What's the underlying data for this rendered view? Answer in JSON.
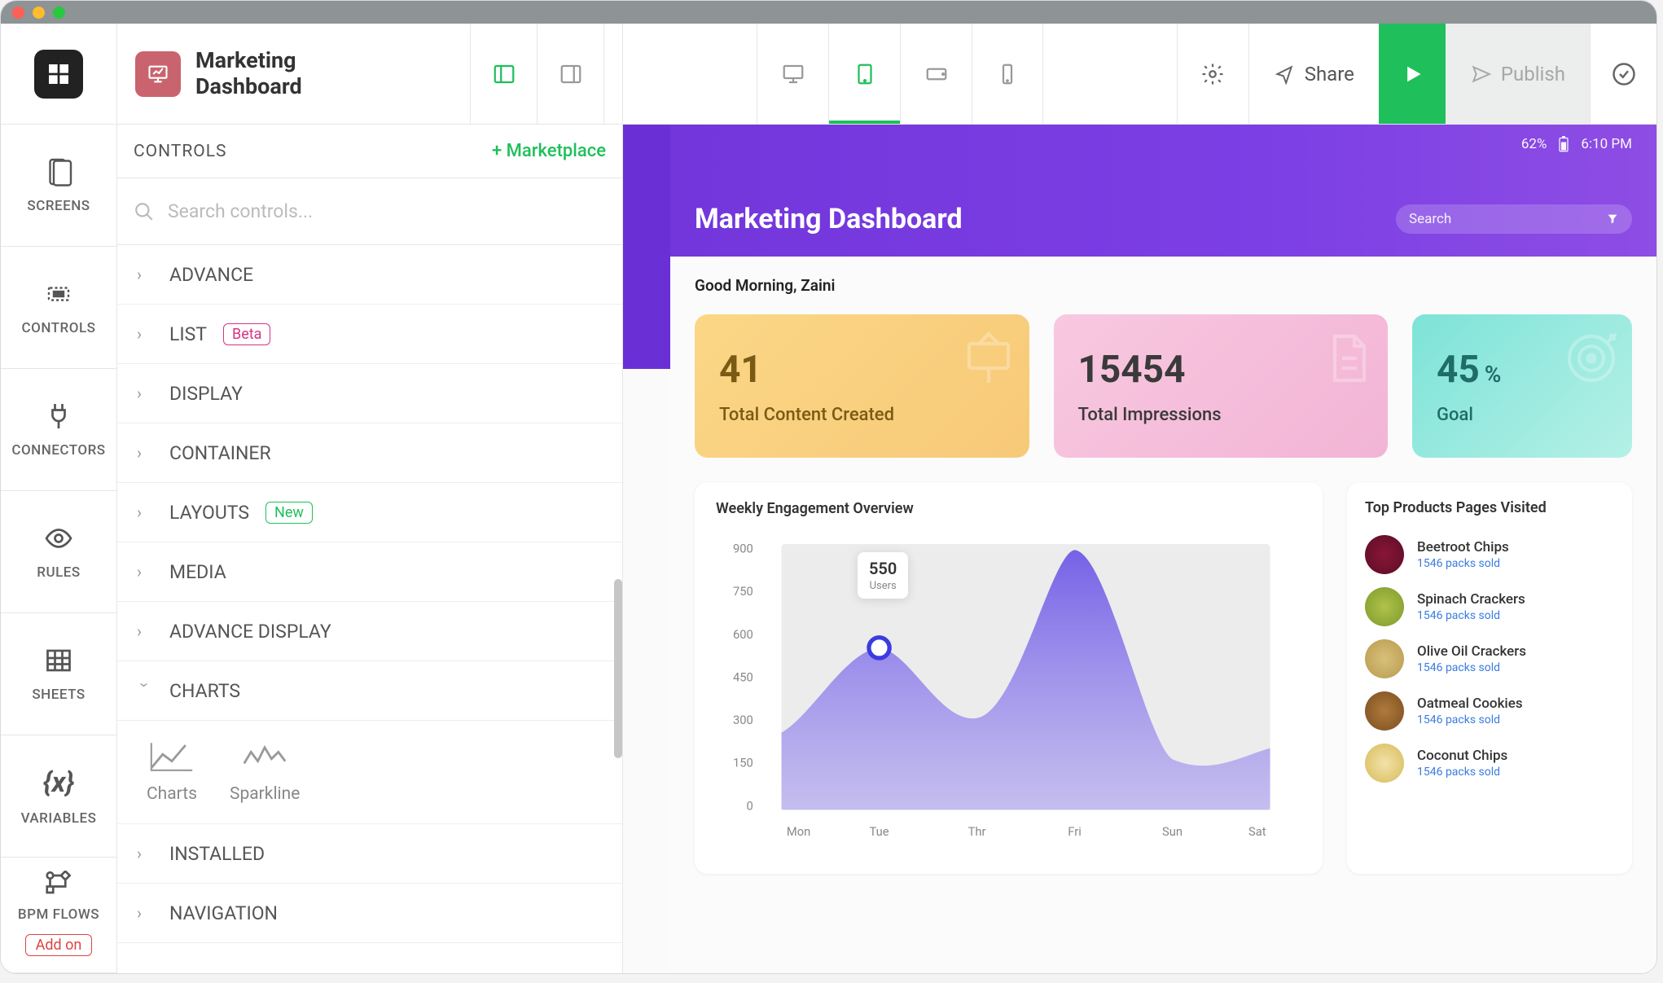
{
  "app": {
    "title": "Marketing Dashboard"
  },
  "rail": {
    "items": [
      {
        "label": "SCREENS"
      },
      {
        "label": "CONTROLS"
      },
      {
        "label": "CONNECTORS"
      },
      {
        "label": "RULES"
      },
      {
        "label": "SHEETS"
      },
      {
        "label": "VARIABLES"
      },
      {
        "label": "BPM FLOWS"
      }
    ],
    "addon": "Add on"
  },
  "controls_panel": {
    "header": "CONTROLS",
    "marketplace": "+ Marketplace",
    "search_placeholder": "Search controls...",
    "categories": [
      {
        "name": "ADVANCE",
        "badge": null,
        "expanded": false
      },
      {
        "name": "LIST",
        "badge": "Beta",
        "badge_type": "beta",
        "expanded": false
      },
      {
        "name": "DISPLAY",
        "badge": null,
        "expanded": false
      },
      {
        "name": "CONTAINER",
        "badge": null,
        "expanded": false
      },
      {
        "name": "LAYOUTS",
        "badge": "New",
        "badge_type": "new",
        "expanded": false
      },
      {
        "name": "MEDIA",
        "badge": null,
        "expanded": false
      },
      {
        "name": "ADVANCE DISPLAY",
        "badge": null,
        "expanded": false
      },
      {
        "name": "CHARTS",
        "badge": null,
        "expanded": true
      },
      {
        "name": "INSTALLED",
        "badge": null,
        "expanded": false
      },
      {
        "name": "NAVIGATION",
        "badge": null,
        "expanded": false
      }
    ],
    "chart_items": [
      {
        "label": "Charts"
      },
      {
        "label": "Sparkline"
      }
    ]
  },
  "toolbar": {
    "share": "Share",
    "publish": "Publish"
  },
  "preview": {
    "statusbar": {
      "battery": "62%",
      "time": "6:10 PM"
    },
    "page_title": "Marketing Dashboard",
    "search_placeholder": "Search",
    "greeting": "Good Morning, Zaini",
    "stats": [
      {
        "value": "41",
        "unit": "",
        "label": "Total Content Created"
      },
      {
        "value": "15454",
        "unit": "",
        "label": "Total Impressions"
      },
      {
        "value": "45",
        "unit": "%",
        "label": "Goal"
      }
    ],
    "chart_title": "Weekly Engagement Overview",
    "tooltip": {
      "value": "550",
      "label": "Users"
    },
    "products_title": "Top Products Pages Visited",
    "products": [
      {
        "name": "Beetroot Chips",
        "sold": "1546 packs sold"
      },
      {
        "name": "Spinach Crackers",
        "sold": "1546 packs sold"
      },
      {
        "name": "Olive Oil Crackers",
        "sold": "1546 packs sold"
      },
      {
        "name": "Oatmeal Cookies",
        "sold": "1546 packs sold"
      },
      {
        "name": "Coconut Chips",
        "sold": "1546 packs sold"
      }
    ]
  },
  "chart_data": {
    "type": "area",
    "title": "Weekly Engagement Overview",
    "xlabel": "",
    "ylabel": "",
    "ylim": [
      0,
      900
    ],
    "y_ticks": [
      0,
      150,
      300,
      450,
      600,
      750,
      900
    ],
    "categories": [
      "Mon",
      "Tue",
      "Thr",
      "Fri",
      "Sun",
      "Sat"
    ],
    "values": [
      260,
      550,
      310,
      880,
      170,
      210
    ],
    "highlight": {
      "index": 1,
      "value": 550,
      "label": "Users"
    }
  },
  "colors": {
    "accent_green": "#1fbf5b",
    "accent_purple": "#7236db",
    "chart_fill": "#6e5ae6"
  }
}
